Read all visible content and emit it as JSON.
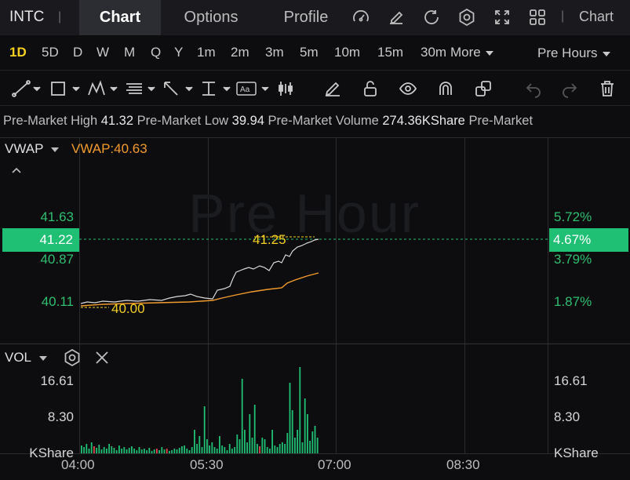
{
  "topbar": {
    "ticker": "INTC",
    "tabs": [
      {
        "label": "Chart"
      },
      {
        "label": "Options"
      },
      {
        "label": "Profile"
      }
    ],
    "right_label": "Chart",
    "icons": [
      "speedometer-icon",
      "edit-icon",
      "refresh-icon",
      "settings-icon",
      "fullscreen-icon",
      "grid-layout-icon"
    ]
  },
  "periods": {
    "items": [
      "1D",
      "5D",
      "D",
      "W",
      "M",
      "Q",
      "Y",
      "1m",
      "2m",
      "3m",
      "5m",
      "10m",
      "15m",
      "30m"
    ],
    "more_label": "More",
    "active": "1D",
    "session": "Pre Hours"
  },
  "premarket": {
    "high_label": "Pre-Market High",
    "high_value": "41.32",
    "low_label": "Pre-Market Low",
    "low_value": "39.94",
    "volume_label": "Pre-Market Volume",
    "volume_value": "274.36KShare",
    "trailing_label": "Pre-Market"
  },
  "indicator": {
    "selector": "VWAP",
    "value_text": "VWAP:40.63"
  },
  "watermark": "Pre Hour",
  "price_axis": {
    "left_ticks": [
      "41.63",
      "40.87",
      "40.11"
    ],
    "current_price": "41.22",
    "right_ticks": [
      "5.72%",
      "3.79%",
      "1.87%"
    ],
    "current_pct": "4.67%",
    "high_marker": "41.25",
    "low_marker": "40.00"
  },
  "volume": {
    "label": "VOL",
    "left_ticks": [
      "16.61",
      "8.30"
    ],
    "left_unit": "KShare",
    "right_ticks": [
      "16.61",
      "8.30"
    ],
    "right_unit": "KShare"
  },
  "time_axis": [
    "04:00",
    "05:30",
    "07:00",
    "08:30"
  ],
  "colors": {
    "up": "#1fbf74",
    "down": "#e5484d",
    "vwap": "#f29b2c",
    "price_line": "#d9d9d9",
    "marker": "#f5d020"
  }
}
